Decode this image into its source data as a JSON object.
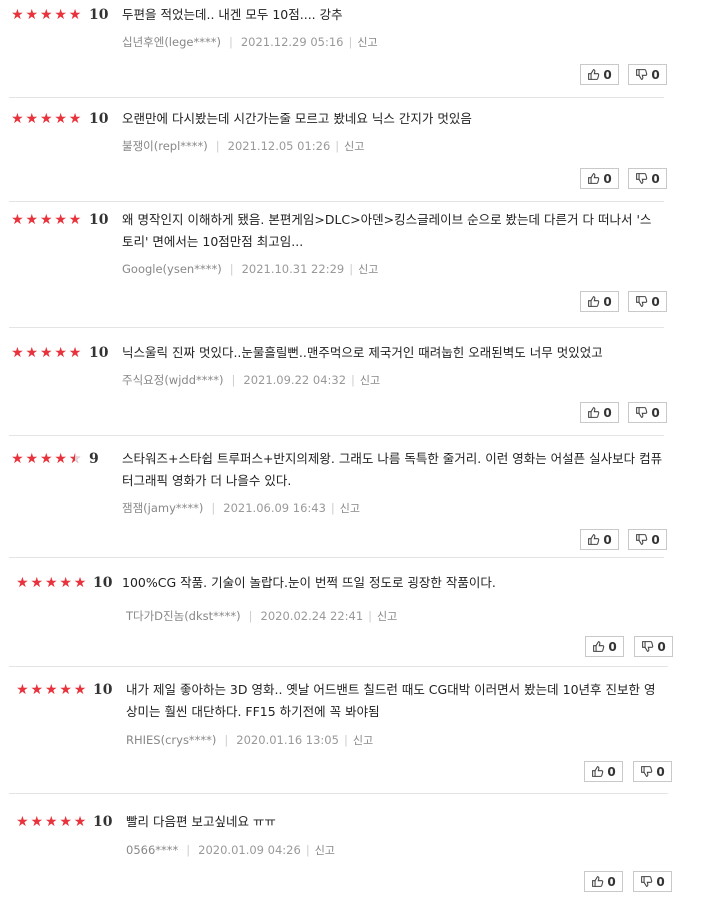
{
  "colors": {
    "star": "#e8323c",
    "divider": "#e4e4e4"
  },
  "reviews": [
    {
      "rating": 10,
      "stars": 5,
      "comment": "두편을 적었는데.. 내겐 모두 10점.... 강추",
      "user": "십년후엔(lege****)",
      "date": "2021.12.29 05:16",
      "report": "신고",
      "likes": "0",
      "dislikes": "0"
    },
    {
      "rating": 10,
      "stars": 5,
      "comment": "오랜만에 다시봤는데 시간가는줄 모르고 봤네요 닉스 간지가 멋있음",
      "user": "불쟁이(repl****)",
      "date": "2021.12.05 01:26",
      "report": "신고",
      "likes": "0",
      "dislikes": "0"
    },
    {
      "rating": 10,
      "stars": 5,
      "comment": "왜 명작인지 이해하게 됐음. 본편게임>DLC>아덴>킹스글레이브 순으로 봤는데 다른거 다 떠나서 '스토리' 면에서는 10점만점 최고임...",
      "user": "Google(ysen****)",
      "date": "2021.10.31 22:29",
      "report": "신고",
      "likes": "0",
      "dislikes": "0"
    },
    {
      "rating": 10,
      "stars": 5,
      "comment": "닉스울릭 진짜 멋있다..눈물흘릴뻔..맨주먹으로 제국거인 때려눕힌 오래된벽도 너무 멋있었고",
      "user": "주식요정(wjdd****)",
      "date": "2021.09.22 04:32",
      "report": "신고",
      "likes": "0",
      "dislikes": "0"
    },
    {
      "rating": 9,
      "stars": 4.5,
      "comment": "스타워즈+스타쉽 트루퍼스+반지의제왕. 그래도 나름 독특한 줄거리. 이런 영화는 어설픈 실사보다 컴퓨터그래픽 영화가 더 나을수 있다.",
      "user": "잼잼(jamy****)",
      "date": "2021.06.09 16:43",
      "report": "신고",
      "likes": "0",
      "dislikes": "0"
    },
    {
      "rating": 10,
      "stars": 5,
      "comment": "100%CG 작품. 기술이 놀랍다.눈이 번쩍 뜨일 정도로 굉장한 작품이다.",
      "user": "T다가D진놈(dkst****)",
      "date": "2020.02.24 22:41",
      "report": "신고",
      "likes": "0",
      "dislikes": "0"
    },
    {
      "rating": 10,
      "stars": 5,
      "comment": "내가 제일 좋아하는 3D 영화.. 옛날 어드밴트 칠드런 때도 CG대박 이러면서 봤는데 10년후 진보한 영상미는 훨씬 대단하다. FF15 하기전에 꼭 봐야됨",
      "user": "RHIES(crys****)",
      "date": "2020.01.16 13:05",
      "report": "신고",
      "likes": "0",
      "dislikes": "0"
    },
    {
      "rating": 10,
      "stars": 5,
      "comment": "빨리 다음편 보고싶네요 ㅠㅠ",
      "user": "0566****",
      "date": "2020.01.09 04:26",
      "report": "신고",
      "likes": "0",
      "dislikes": "0"
    }
  ]
}
